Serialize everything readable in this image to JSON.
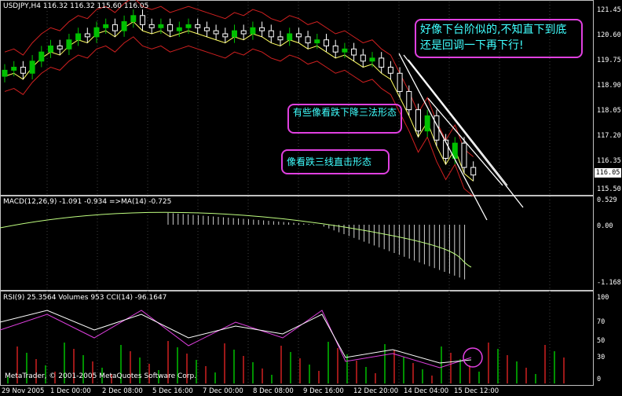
{
  "colors": {
    "background": "#000000",
    "bull": "#00c000",
    "bear": "#ffffff",
    "upper_band": "#d02020",
    "annot_border": "#e040e0",
    "annot_text": "#40ffff"
  },
  "price": {
    "header": "USDJPY,H4  116.32 116.32 115.60 116.05",
    "current_price": "116.05",
    "axis": [
      "121.45",
      "120.60",
      "119.75",
      "118.90",
      "118.05",
      "117.20",
      "116.35",
      "115.50"
    ]
  },
  "macd": {
    "header": "MACD(12,26,9) -1.091 -0.934  =>MA(14) -0.725",
    "axis": [
      "0.529",
      "0.00",
      "-1.168"
    ]
  },
  "rsi": {
    "header": "RSI(9) 25.3564  Volumes 953  CCI(14) -96.1647",
    "axis": [
      "100",
      "70",
      "50",
      "30",
      "0"
    ]
  },
  "annotations": {
    "note_top": "好像下台阶似的,不知直下到底还是回调一下再下行!",
    "note_mid": "有些像看跌下降三法形态",
    "note_bottom": "像看跌三线直击形态"
  },
  "copyright": "MetaTrader, © 2001-2005 MetaQuotes Software Corp.",
  "time_axis": [
    "29 Nov 2005",
    "1 Dec 00:00",
    "2 Dec 08:00",
    "5 Dec 16:00",
    "7 Dec 00:00",
    "8 Dec 08:00",
    "9 Dec 16:00",
    "12 Dec 20:00",
    "14 Dec 04:00",
    "15 Dec 12:00"
  ],
  "chart_data": {
    "type": "candlestick",
    "symbol": "USDJPY",
    "timeframe": "H4",
    "ylim": [
      115.5,
      121.45
    ],
    "close_series": [
      119.5,
      119.6,
      119.4,
      119.8,
      120.1,
      120.3,
      120.2,
      120.5,
      120.7,
      120.6,
      120.9,
      121.0,
      120.8,
      121.1,
      121.3,
      121.0,
      120.9,
      121.0,
      120.8,
      120.9,
      121.0,
      120.9,
      120.8,
      120.7,
      120.6,
      120.8,
      120.7,
      120.9,
      120.8,
      120.6,
      120.5,
      120.7,
      120.6,
      120.4,
      120.5,
      120.3,
      120.1,
      120.2,
      120.0,
      119.8,
      119.9,
      119.6,
      119.4,
      118.8,
      118.2,
      117.5,
      118.0,
      117.2,
      116.6,
      117.1,
      116.3,
      116.05
    ]
  }
}
